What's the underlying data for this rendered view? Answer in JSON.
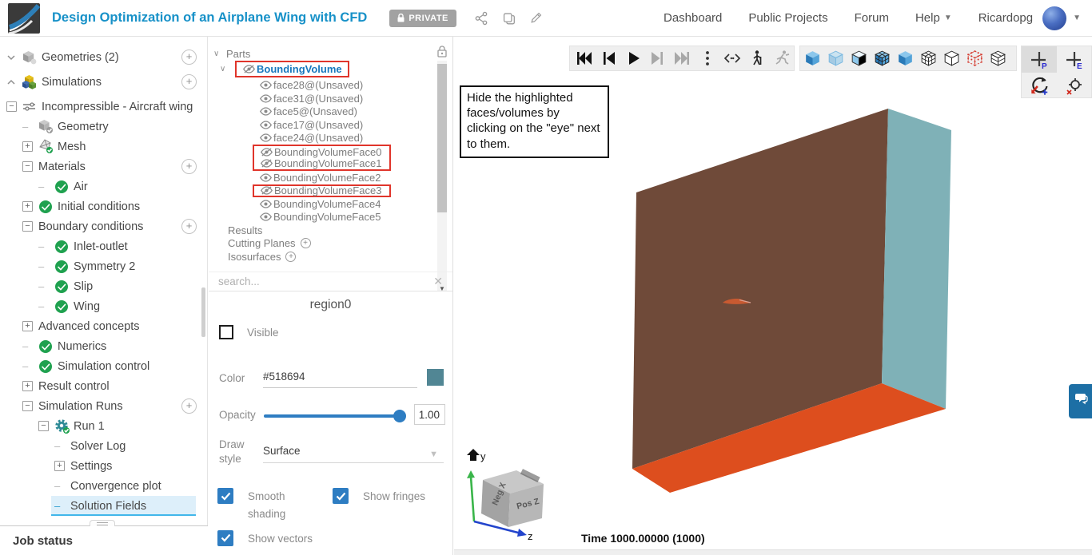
{
  "header": {
    "title": "Design Optimization of an Airplane Wing with CFD",
    "privacy_badge": "PRIVATE",
    "actions": [
      "share",
      "copy",
      "edit"
    ],
    "nav": [
      {
        "label": "Dashboard"
      },
      {
        "label": "Public Projects"
      },
      {
        "label": "Forum"
      },
      {
        "label": "Help",
        "dropdown": true
      }
    ],
    "username": "Ricardopg"
  },
  "sidebar": {
    "items": [
      {
        "label": "Geometries (2)",
        "level": 0,
        "exp": "chevron-down",
        "icon": "geometry-icon",
        "plus": true,
        "gap": true
      },
      {
        "label": "Simulations",
        "level": 0,
        "exp": "chevron-up",
        "icon": "simulations-icon",
        "plus": true,
        "gap": true
      },
      {
        "label": "Incompressible - Aircraft wing",
        "level": 1,
        "exp": "minus",
        "icon": "incompressible-icon"
      },
      {
        "label": "Geometry",
        "level": 2,
        "exp": "dash",
        "icon": "geometry-check-icon"
      },
      {
        "label": "Mesh",
        "level": 2,
        "exp": "plus",
        "icon": "mesh-check-icon"
      },
      {
        "label": "Materials",
        "level": 2,
        "exp": "minus",
        "plus": true
      },
      {
        "label": "Air",
        "level": 3,
        "exp": "dash",
        "icon": "check-icon"
      },
      {
        "label": "Initial conditions",
        "level": 2,
        "exp": "plus",
        "icon": "check-icon"
      },
      {
        "label": "Boundary conditions",
        "level": 2,
        "exp": "minus",
        "plus": true
      },
      {
        "label": "Inlet-outlet",
        "level": 3,
        "exp": "dash",
        "icon": "check-icon"
      },
      {
        "label": "Symmetry 2",
        "level": 3,
        "exp": "dash",
        "icon": "check-icon"
      },
      {
        "label": "Slip",
        "level": 3,
        "exp": "dash",
        "icon": "check-icon"
      },
      {
        "label": "Wing",
        "level": 3,
        "exp": "dash",
        "icon": "check-icon"
      },
      {
        "label": "Advanced concepts",
        "level": 2,
        "exp": "plus"
      },
      {
        "label": "Numerics",
        "level": 2,
        "exp": "dash",
        "icon": "check-icon"
      },
      {
        "label": "Simulation control",
        "level": 2,
        "exp": "dash",
        "icon": "check-icon"
      },
      {
        "label": "Result control",
        "level": 2,
        "exp": "plus"
      },
      {
        "label": "Simulation Runs",
        "level": 2,
        "exp": "minus",
        "plus": true
      },
      {
        "label": "Run 1",
        "level": 3,
        "exp": "minus",
        "icon": "gear-check-icon"
      },
      {
        "label": "Solver Log",
        "level": 4,
        "exp": "dash"
      },
      {
        "label": "Settings",
        "level": 4,
        "exp": "plus"
      },
      {
        "label": "Convergence plot",
        "level": 4,
        "exp": "dash"
      },
      {
        "label": "Solution Fields",
        "level": 4,
        "exp": "dash",
        "selected": true
      }
    ],
    "job_status_label": "Job status"
  },
  "parts_panel": {
    "tree": [
      {
        "label": "Parts",
        "level": 0,
        "chevron": true
      },
      {
        "label": "BoundingVolume",
        "level": 1,
        "chevron": true,
        "icon": "eye-off",
        "emphasis": true,
        "outline": "full"
      },
      {
        "label": "face28@(Unsaved)",
        "level": 2,
        "icon": "eye"
      },
      {
        "label": "face31@(Unsaved)",
        "level": 2,
        "icon": "eye"
      },
      {
        "label": "face5@(Unsaved)",
        "level": 2,
        "icon": "eye"
      },
      {
        "label": "face17@(Unsaved)",
        "level": 2,
        "icon": "eye"
      },
      {
        "label": "face24@(Unsaved)",
        "level": 2,
        "icon": "eye"
      },
      {
        "label": "BoundingVolumeFace0",
        "level": 2,
        "icon": "eye-off",
        "outline": "jt"
      },
      {
        "label": "BoundingVolumeFace1",
        "level": 2,
        "icon": "eye-off",
        "outline": "jb"
      },
      {
        "label": "BoundingVolumeFace2",
        "level": 2,
        "icon": "eye"
      },
      {
        "label": "BoundingVolumeFace3",
        "level": 2,
        "icon": "eye-off",
        "outline": "full"
      },
      {
        "label": "BoundingVolumeFace4",
        "level": 2,
        "icon": "eye"
      },
      {
        "label": "BoundingVolumeFace5",
        "level": 2,
        "icon": "eye"
      },
      {
        "label": "Results",
        "level": 1
      },
      {
        "label": "Cutting Planes",
        "level": 1,
        "plus_badge": true
      },
      {
        "label": "Isosurfaces",
        "level": 1,
        "plus_badge": true
      }
    ],
    "search_placeholder": "search..."
  },
  "properties": {
    "title": "region0",
    "visible": {
      "label": "Visible",
      "checked": false
    },
    "color": {
      "label": "Color",
      "value": "#518694",
      "swatch": "#518694"
    },
    "opacity": {
      "label": "Opacity",
      "value": "1.00",
      "fraction": 1.0
    },
    "draw_style": {
      "label": "Draw style",
      "value": "Surface"
    },
    "options": [
      {
        "label": "Smooth shading",
        "checked": true
      },
      {
        "label": "Show fringes",
        "checked": true
      },
      {
        "label": "Show vectors",
        "checked": true
      }
    ]
  },
  "viewport": {
    "toolbar": {
      "playback": [
        "skip-to-start",
        "step-back",
        "play",
        "step-forward",
        "skip-to-end",
        "more-options",
        "fit-range",
        "walk-mode",
        "fly-mode"
      ],
      "view_modes": [
        "solid",
        "transparent",
        "surface-with-edges",
        "surface-mesh",
        "solid-shaded",
        "wireframe-mesh",
        "wireframe",
        "point-cloud",
        "hidden-line"
      ],
      "tools": [
        "probe-point",
        "probe-element",
        "rotate-camera",
        "center-of-rotation"
      ]
    },
    "annotation": "Hide the highlighted faces/volumes by clicking on the \"eye\" next to them.",
    "axis_labels": {
      "y": "y",
      "z": "z",
      "cube_left": "Neg X",
      "cube_right": "Pos Z"
    },
    "time_label": "Time 1000.00000 (1000)",
    "scene_colors": {
      "front_face": "#6f4a39",
      "side_face": "#7fb1b7",
      "bottom_face": "#dd4e1e",
      "airfoil": "#c85a31"
    }
  }
}
